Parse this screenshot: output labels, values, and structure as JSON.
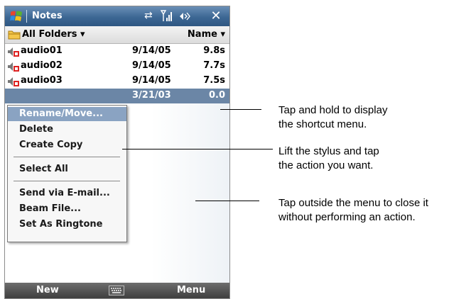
{
  "titlebar": {
    "app_title": "Notes",
    "icons": [
      "windows-logo-icon",
      "sync-icon",
      "signal-icon",
      "volume-icon",
      "close-icon"
    ],
    "close_glyph": "✕"
  },
  "toolbar": {
    "folder_label": "All Folders ▾",
    "sort_label": "Name ▾"
  },
  "files": [
    {
      "name": "audio01",
      "date": "9/14/05",
      "size": "9.8s",
      "selected": false
    },
    {
      "name": "audio02",
      "date": "9/14/05",
      "size": "7.7s",
      "selected": false
    },
    {
      "name": "audio03",
      "date": "9/14/05",
      "size": "7.5s",
      "selected": false
    },
    {
      "name": "",
      "date": "3/21/03",
      "size": "0.0",
      "selected": true
    }
  ],
  "context_menu": {
    "items": [
      {
        "label": "Rename/Move...",
        "highlighted": true
      },
      {
        "label": "Delete"
      },
      {
        "label": "Create Copy"
      },
      {
        "label": "Select All"
      },
      {
        "label": "Send via E-mail..."
      },
      {
        "label": "Beam File..."
      },
      {
        "label": "Set As Ringtone"
      }
    ]
  },
  "bottombar": {
    "left_label": "New",
    "right_label": "Menu",
    "keyboard_icon": "keyboard-icon"
  },
  "callouts": {
    "c1_line1": "Tap and hold to display",
    "c1_line2": "the shortcut menu.",
    "c2_line1": "Lift the stylus and tap",
    "c2_line2": "the action you want.",
    "c3_line1": "Tap outside the menu to close it",
    "c3_line2": "without performing an action."
  },
  "colors": {
    "titlebar": "#3c6794",
    "selected_row": "#6b86a6",
    "menu_highlight": "#8aa3c2",
    "bottombar": "#4a4a4a"
  }
}
